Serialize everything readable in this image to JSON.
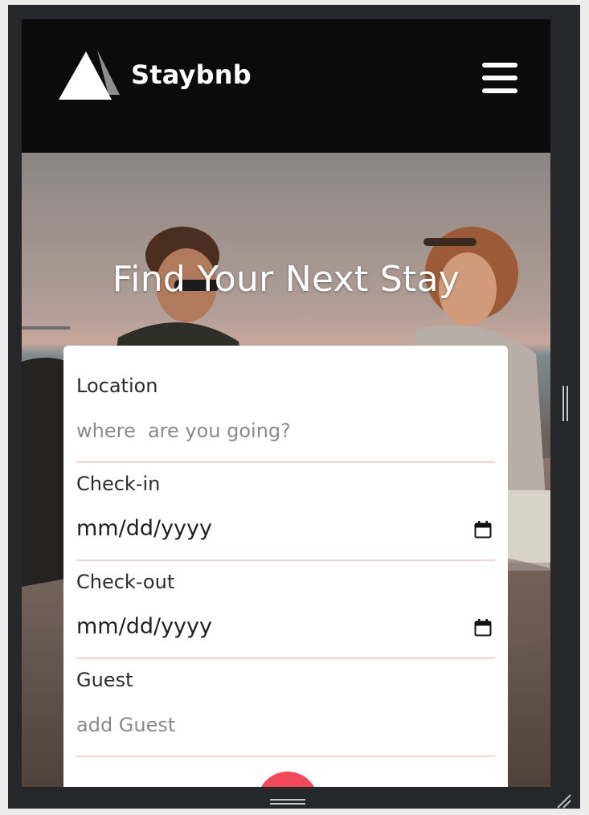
{
  "navbar": {
    "brand": "Staybnb",
    "logo_icon": "triangle-logo-icon",
    "menu_icon": "hamburger-menu-icon"
  },
  "hero": {
    "title": "Find Your Next Stay"
  },
  "search_form": {
    "location": {
      "label": "Location",
      "placeholder": "where  are you going?"
    },
    "checkin": {
      "label": "Check-in",
      "value": "mm/dd/yyyy",
      "icon": "calendar-icon"
    },
    "checkout": {
      "label": "Check-out",
      "value": "mm/dd/yyyy",
      "icon": "calendar-icon"
    },
    "guest": {
      "label": "Guest",
      "placeholder": "add Guest"
    }
  },
  "colors": {
    "navbar_bg": "#0b0b0b",
    "accent": "#f2485a",
    "divider": "#f8d2d2",
    "frame": "#26272a"
  }
}
